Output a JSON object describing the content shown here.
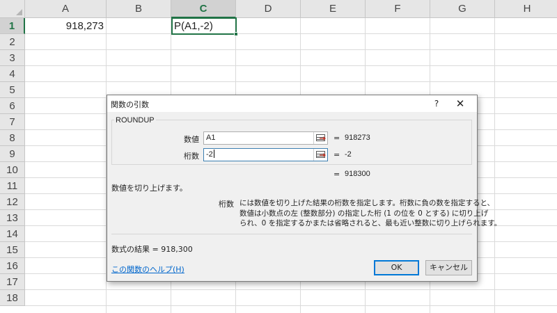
{
  "sheet": {
    "columns": [
      "A",
      "B",
      "C",
      "D",
      "E",
      "F",
      "G",
      "H"
    ],
    "rows": [
      "1",
      "2",
      "3",
      "4",
      "5",
      "6",
      "7",
      "8",
      "9",
      "10",
      "11",
      "12",
      "13",
      "14",
      "15",
      "16",
      "17",
      "18"
    ],
    "active_column": "C",
    "active_row": "1",
    "cells": {
      "A1": "918,273",
      "C1": "P(A1,-2)"
    },
    "accent_color": "#217346"
  },
  "dialog": {
    "title": "関数の引数",
    "help_symbol": "?",
    "close_symbol": "✕",
    "function_name": "ROUNDUP",
    "args": [
      {
        "label": "数値",
        "value": "A1",
        "equals": "=",
        "result": "918273"
      },
      {
        "label": "桁数",
        "value": "-2",
        "equals": "=",
        "result": "-2"
      }
    ],
    "function_result_equals": "=",
    "function_result": "918300",
    "description": "数値を切り上げます。",
    "arg_help_name": "桁数",
    "arg_help_lines": [
      "には数値を切り上げた結果の桁数を指定します。桁数に負の数を指定すると、",
      "数値は小数点の左 (整数部分) の指定した桁 (1 の位を 0 とする) に切り上げ",
      "られ、0 を指定するかまたは省略されると、最も近い整数に切り上げられます。"
    ],
    "formula_result_label": "数式の結果 =",
    "formula_result_value": "918,300",
    "help_link": "この関数のヘルプ(H)",
    "ok_label": "OK",
    "cancel_label": "キャンセル"
  }
}
